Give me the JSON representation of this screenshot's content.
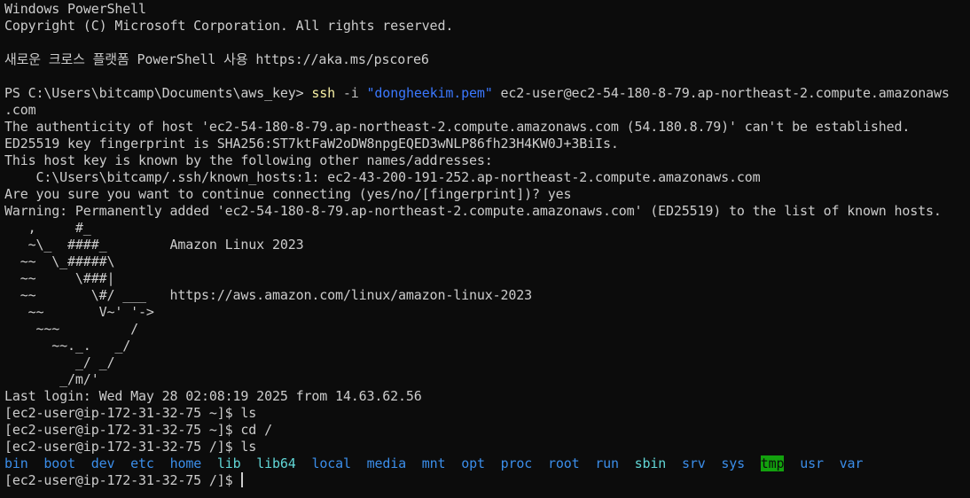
{
  "window": {
    "title": "Windows PowerShell"
  },
  "colors": {
    "background": "#0c0c0c",
    "foreground": "#cccccc",
    "command": "#f9f1a5",
    "string": "#3b78ff",
    "directory": "#3b8eea",
    "directory_alt": "#61d6d6",
    "sticky_dir_bg": "#13a10e"
  },
  "lines": {
    "l01": "Windows PowerShell",
    "l02": "Copyright (C) Microsoft Corporation. All rights reserved.",
    "l03": "",
    "l04": "새로운 크로스 플랫폼 PowerShell 사용 https://aka.ms/pscore6",
    "l05": "",
    "l06_prompt": "PS C:\\Users\\bitcamp\\Documents\\aws_key> ",
    "l06_cmd": "ssh",
    "l06_flag": " -i ",
    "l06_key": "\"dongheekim.pem\"",
    "l06_target": " ec2-user@ec2-54-180-8-79.ap-northeast-2.compute.amazonaws",
    "l07": ".com",
    "l08": "The authenticity of host 'ec2-54-180-8-79.ap-northeast-2.compute.amazonaws.com (54.180.8.79)' can't be established.",
    "l09": "ED25519 key fingerprint is SHA256:ST7ktFaW2oDW8npgEQED3wNLP86fh23H4KW0J+3BiIs.",
    "l10": "This host key is known by the following other names/addresses:",
    "l11": "    C:\\Users\\bitcamp/.ssh/known_hosts:1: ec2-43-200-191-252.ap-northeast-2.compute.amazonaws.com",
    "l12": "Are you sure you want to continue connecting (yes/no/[fingerprint])? yes",
    "l13": "Warning: Permanently added 'ec2-54-180-8-79.ap-northeast-2.compute.amazonaws.com' (ED25519) to the list of known hosts.",
    "l14": "   ,     #_",
    "l15": "   ~\\_  ####_        Amazon Linux 2023",
    "l16": "  ~~  \\_#####\\",
    "l17": "  ~~     \\###|",
    "l18": "  ~~       \\#/ ___   https://aws.amazon.com/linux/amazon-linux-2023",
    "l19": "   ~~       V~' '->",
    "l20": "    ~~~         /",
    "l21": "      ~~._.   _/",
    "l22": "         _/ _/",
    "l23": "       _/m/'",
    "l24": "Last login: Wed May 28 02:08:19 2025 from 14.63.62.56",
    "l25": "[ec2-user@ip-172-31-32-75 ~]$ ls",
    "l26": "[ec2-user@ip-172-31-32-75 ~]$ cd /",
    "l27": "[ec2-user@ip-172-31-32-75 /]$ ls",
    "l29_prompt": "[ec2-user@ip-172-31-32-75 /]$ "
  },
  "ls_output": [
    {
      "name": "bin",
      "style": "dir"
    },
    {
      "name": "boot",
      "style": "dir"
    },
    {
      "name": "dev",
      "style": "dir"
    },
    {
      "name": "etc",
      "style": "dir"
    },
    {
      "name": "home",
      "style": "dir"
    },
    {
      "name": "lib",
      "style": "dir-cyan"
    },
    {
      "name": "lib64",
      "style": "dir-cyan"
    },
    {
      "name": "local",
      "style": "dir"
    },
    {
      "name": "media",
      "style": "dir"
    },
    {
      "name": "mnt",
      "style": "dir"
    },
    {
      "name": "opt",
      "style": "dir"
    },
    {
      "name": "proc",
      "style": "dir"
    },
    {
      "name": "root",
      "style": "dir"
    },
    {
      "name": "run",
      "style": "dir"
    },
    {
      "name": "sbin",
      "style": "dir-cyan"
    },
    {
      "name": "srv",
      "style": "dir"
    },
    {
      "name": "sys",
      "style": "dir"
    },
    {
      "name": "tmp",
      "style": "dir-tmp"
    },
    {
      "name": "usr",
      "style": "dir"
    },
    {
      "name": "var",
      "style": "dir"
    }
  ]
}
